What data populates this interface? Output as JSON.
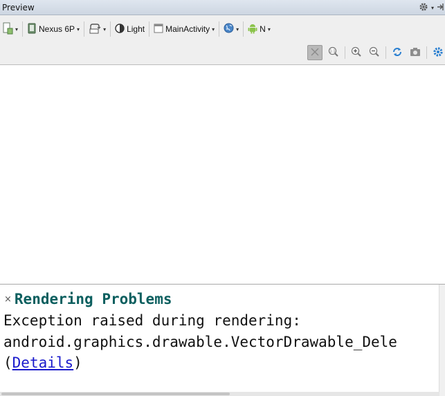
{
  "window": {
    "title": "Preview"
  },
  "toolbar": {
    "device_label": "Nexus 6P",
    "theme_label": "Light",
    "activity_label": "MainActivity",
    "api_label": "N",
    "caret": "▾"
  },
  "problems": {
    "close_glyph": "×",
    "heading": "Rendering Problems",
    "line1": "Exception raised during rendering:",
    "line2": "android.graphics.drawable.VectorDrawable_Dele",
    "details_open": "(",
    "details_link": "Details",
    "details_close": ")"
  },
  "colors": {
    "heading": "#0c5f5f",
    "link": "#1a1acc",
    "android": "#8bc34a",
    "accent_blue": "#2a7fd0"
  }
}
